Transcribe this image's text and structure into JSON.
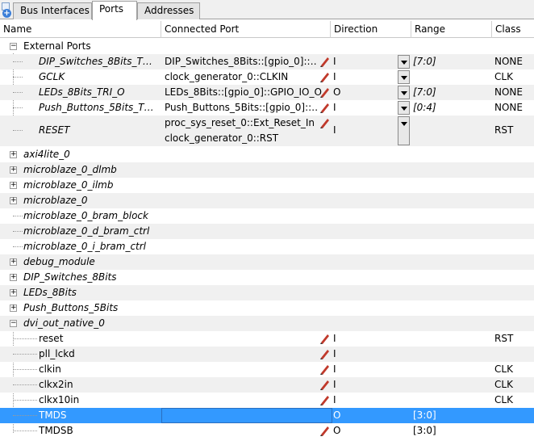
{
  "tabs": [
    {
      "label": "Bus Interfaces",
      "active": false
    },
    {
      "label": "Ports",
      "active": true
    },
    {
      "label": "Addresses",
      "active": false
    }
  ],
  "columns": {
    "name": "Name",
    "connected_port": "Connected Port",
    "direction": "Direction",
    "range": "Range",
    "class": "Class"
  },
  "external_ports": {
    "label": "External Ports",
    "rows": [
      {
        "name": "DIP_Switches_8Bits_T…",
        "port": "DIP_Switches_8Bits::[gpio_0]::…",
        "dir": "I",
        "range": "[7:0]",
        "class": "NONE"
      },
      {
        "name": "GCLK",
        "port": "clock_generator_0::CLKIN",
        "dir": "I",
        "range": "",
        "class": "CLK"
      },
      {
        "name": "LEDs_8Bits_TRI_O",
        "port": "LEDs_8Bits::[gpio_0]::GPIO_IO_O",
        "dir": "O",
        "range": "[7:0]",
        "class": "NONE"
      },
      {
        "name": "Push_Buttons_5Bits_T…",
        "port": "Push_Buttons_5Bits::[gpio_0]::…",
        "dir": "I",
        "range": "[0:4]",
        "class": "NONE"
      },
      {
        "name": "RESET",
        "port": "proc_sys_reset_0::Ext_Reset_In",
        "port2": "clock_generator_0::RST",
        "dir": "I",
        "range": "",
        "class": "RST"
      }
    ]
  },
  "instances": [
    {
      "label": "axi4lite_0",
      "expandable": true
    },
    {
      "label": "microblaze_0_dlmb",
      "expandable": true
    },
    {
      "label": "microblaze_0_ilmb",
      "expandable": true
    },
    {
      "label": "microblaze_0",
      "expandable": true
    },
    {
      "label": "microblaze_0_bram_block",
      "expandable": false
    },
    {
      "label": "microblaze_0_d_bram_ctrl",
      "expandable": false
    },
    {
      "label": "microblaze_0_i_bram_ctrl",
      "expandable": false
    },
    {
      "label": "debug_module",
      "expandable": true
    },
    {
      "label": "DIP_Switches_8Bits",
      "expandable": true
    },
    {
      "label": "LEDs_8Bits",
      "expandable": true
    },
    {
      "label": "Push_Buttons_5Bits",
      "expandable": true
    },
    {
      "label": "dvi_out_native_0",
      "expandable": true,
      "expanded": true
    }
  ],
  "dvi_ports": [
    {
      "name": "reset",
      "dir": "I",
      "range": "",
      "class": "RST"
    },
    {
      "name": "pll_lckd",
      "dir": "I",
      "range": "",
      "class": ""
    },
    {
      "name": "clkin",
      "dir": "I",
      "range": "",
      "class": "CLK"
    },
    {
      "name": "clkx2in",
      "dir": "I",
      "range": "",
      "class": "CLK"
    },
    {
      "name": "clkx10in",
      "dir": "I",
      "range": "",
      "class": "CLK"
    },
    {
      "name": "TMDS",
      "dir": "O",
      "range": "[3:0]",
      "class": "",
      "selected": true
    },
    {
      "name": "TMDSB",
      "dir": "O",
      "range": "[3:0]",
      "class": ""
    }
  ],
  "icons": {
    "pencil": "pencil-icon",
    "dropdown": "chevron-down-icon",
    "expander_plus": "expand-icon",
    "expander_minus": "collapse-icon"
  },
  "colors": {
    "selection": "#3399ff",
    "alt_row": "#f0f0f0"
  }
}
